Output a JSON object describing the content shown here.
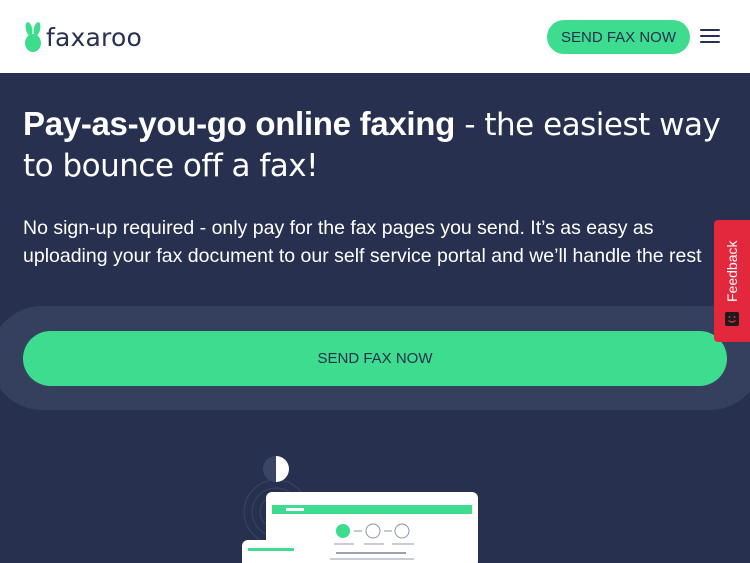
{
  "brand": {
    "name": "faxaroo",
    "accent": "#3ddc8f",
    "navy": "#27304f",
    "feedback_red": "#e3283e"
  },
  "header": {
    "cta_label": "SEND FAX NOW",
    "menu_icon": "hamburger-icon"
  },
  "hero": {
    "headline_bold": "Pay-as-you-go online faxing",
    "headline_light": " - the easiest way to bounce off a fax!",
    "subtext": "No sign-up required - only pay for the fax pages you send. It’s as easy as uploading your fax document to our self service portal and we’ll handle the rest",
    "cta_label": "SEND FAX NOW"
  },
  "feedback": {
    "label": "Feedback",
    "icon": "smile-icon"
  }
}
